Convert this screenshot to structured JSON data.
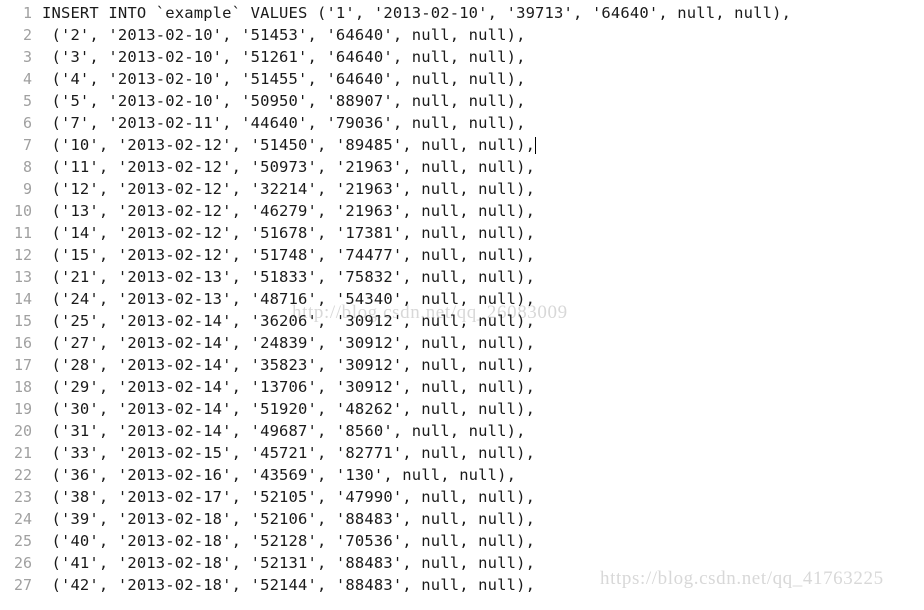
{
  "editor": {
    "background_color": "#ffffff",
    "text_color": "#1a1a1a",
    "line_number_color": "#a0a0a0",
    "caret_line": 7,
    "caret_color": "#000000"
  },
  "watermarks": {
    "middle": "http://blog.csdn.net/qq_26083009",
    "bottom": "https://blog.csdn.net/qq_41763225",
    "color": "#d8d8d8"
  },
  "lines": [
    {
      "number": "1",
      "text": "INSERT INTO `example` VALUES ('1', '2013-02-10', '39713', '64640', null, null),"
    },
    {
      "number": "2",
      "text": " ('2', '2013-02-10', '51453', '64640', null, null),"
    },
    {
      "number": "3",
      "text": " ('3', '2013-02-10', '51261', '64640', null, null),"
    },
    {
      "number": "4",
      "text": " ('4', '2013-02-10', '51455', '64640', null, null),"
    },
    {
      "number": "5",
      "text": " ('5', '2013-02-10', '50950', '88907', null, null),"
    },
    {
      "number": "6",
      "text": " ('7', '2013-02-11', '44640', '79036', null, null),"
    },
    {
      "number": "7",
      "text": " ('10', '2013-02-12', '51450', '89485', null, null),"
    },
    {
      "number": "8",
      "text": " ('11', '2013-02-12', '50973', '21963', null, null),"
    },
    {
      "number": "9",
      "text": " ('12', '2013-02-12', '32214', '21963', null, null),"
    },
    {
      "number": "10",
      "text": " ('13', '2013-02-12', '46279', '21963', null, null),"
    },
    {
      "number": "11",
      "text": " ('14', '2013-02-12', '51678', '17381', null, null),"
    },
    {
      "number": "12",
      "text": " ('15', '2013-02-12', '51748', '74477', null, null),"
    },
    {
      "number": "13",
      "text": " ('21', '2013-02-13', '51833', '75832', null, null),"
    },
    {
      "number": "14",
      "text": " ('24', '2013-02-13', '48716', '54340', null, null),"
    },
    {
      "number": "15",
      "text": " ('25', '2013-02-14', '36206', '30912', null, null),"
    },
    {
      "number": "16",
      "text": " ('27', '2013-02-14', '24839', '30912', null, null),"
    },
    {
      "number": "17",
      "text": " ('28', '2013-02-14', '35823', '30912', null, null),"
    },
    {
      "number": "18",
      "text": " ('29', '2013-02-14', '13706', '30912', null, null),"
    },
    {
      "number": "19",
      "text": " ('30', '2013-02-14', '51920', '48262', null, null),"
    },
    {
      "number": "20",
      "text": " ('31', '2013-02-14', '49687', '8560', null, null),"
    },
    {
      "number": "21",
      "text": " ('33', '2013-02-15', '45721', '82771', null, null),"
    },
    {
      "number": "22",
      "text": " ('36', '2013-02-16', '43569', '130', null, null),"
    },
    {
      "number": "23",
      "text": " ('38', '2013-02-17', '52105', '47990', null, null),"
    },
    {
      "number": "24",
      "text": " ('39', '2013-02-18', '52106', '88483', null, null),"
    },
    {
      "number": "25",
      "text": " ('40', '2013-02-18', '52128', '70536', null, null),"
    },
    {
      "number": "26",
      "text": " ('41', '2013-02-18', '52131', '88483', null, null),"
    },
    {
      "number": "27",
      "text": " ('42', '2013-02-18', '52144', '88483', null, null),"
    }
  ]
}
